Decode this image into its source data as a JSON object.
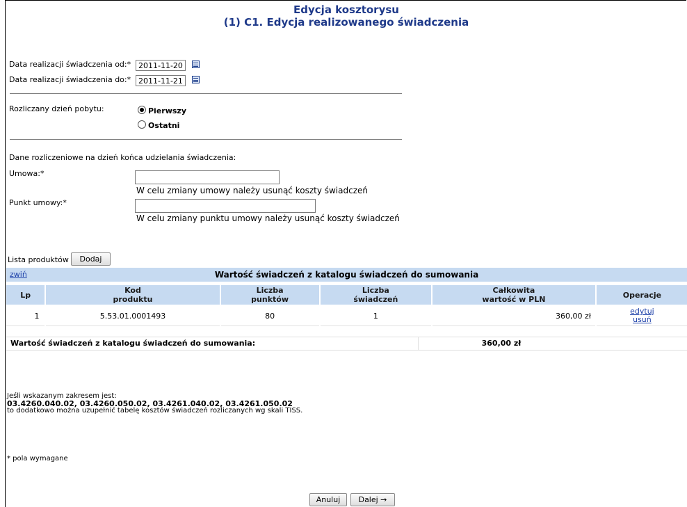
{
  "header": {
    "title_line1": "Edycja kosztorysu",
    "title_line2": "(1) C1. Edycja realizowanego świadczenia"
  },
  "dates": {
    "from_label": "Data realizacji świadczenia od:*",
    "from_value": "2011-11-20",
    "to_label": "Data realizacji świadczenia do:*",
    "to_value": "2011-11-21",
    "icon": "calendar-icon"
  },
  "stay_day": {
    "label": "Rozliczany dzień pobytu:",
    "options": [
      {
        "label": "Pierwszy",
        "selected": true
      },
      {
        "label": "Ostatni",
        "selected": false
      }
    ]
  },
  "settlement": {
    "heading": "Dane rozliczeniowe na dzień końca udzielania świadczenia:",
    "contract_label": "Umowa:*",
    "contract_value": "",
    "contract_hint": "W celu zmiany umowy należy usunąć koszty świadczeń",
    "point_label": "Punkt umowy:*",
    "point_value": "",
    "point_hint": "W celu zmiany punktu umowy należy usunąć koszty świadczeń"
  },
  "products": {
    "list_label": "Lista produktów",
    "add_button": "Dodaj",
    "collapse_link": "zwiń",
    "section_title": "Wartość świadczeń z katalogu świadczeń do sumowania",
    "columns": {
      "lp": "Lp",
      "code_1": "Kod",
      "code_2": "produktu",
      "points_1": "Liczba",
      "points_2": "punktów",
      "count_1": "Liczba",
      "count_2": "świadczeń",
      "total_1": "Całkowita",
      "total_2": "wartość w PLN",
      "ops": "Operacje"
    },
    "rows": [
      {
        "lp": "1",
        "code": "5.53.01.0001493",
        "points": "80",
        "count": "1",
        "total": "360,00 zł",
        "edit": "edytuj",
        "delete": "usuń"
      }
    ],
    "sum_label": "Wartość świadczeń z katalogu świadczeń do sumowania:",
    "sum_value": "360,00 zł"
  },
  "info": {
    "line1": "Jeśli wskazanym zakresem jest:",
    "line2": "03.4260.040.02, 03.4260.050.02, 03.4261.040.02, 03.4261.050.02",
    "line3": "to dodatkowo można uzupełnić tabelę kosztów świadczeń rozliczanych wg skali TISS."
  },
  "required_note": "* pola wymagane",
  "footer": {
    "cancel": "Anuluj",
    "next": "Dalej →"
  }
}
